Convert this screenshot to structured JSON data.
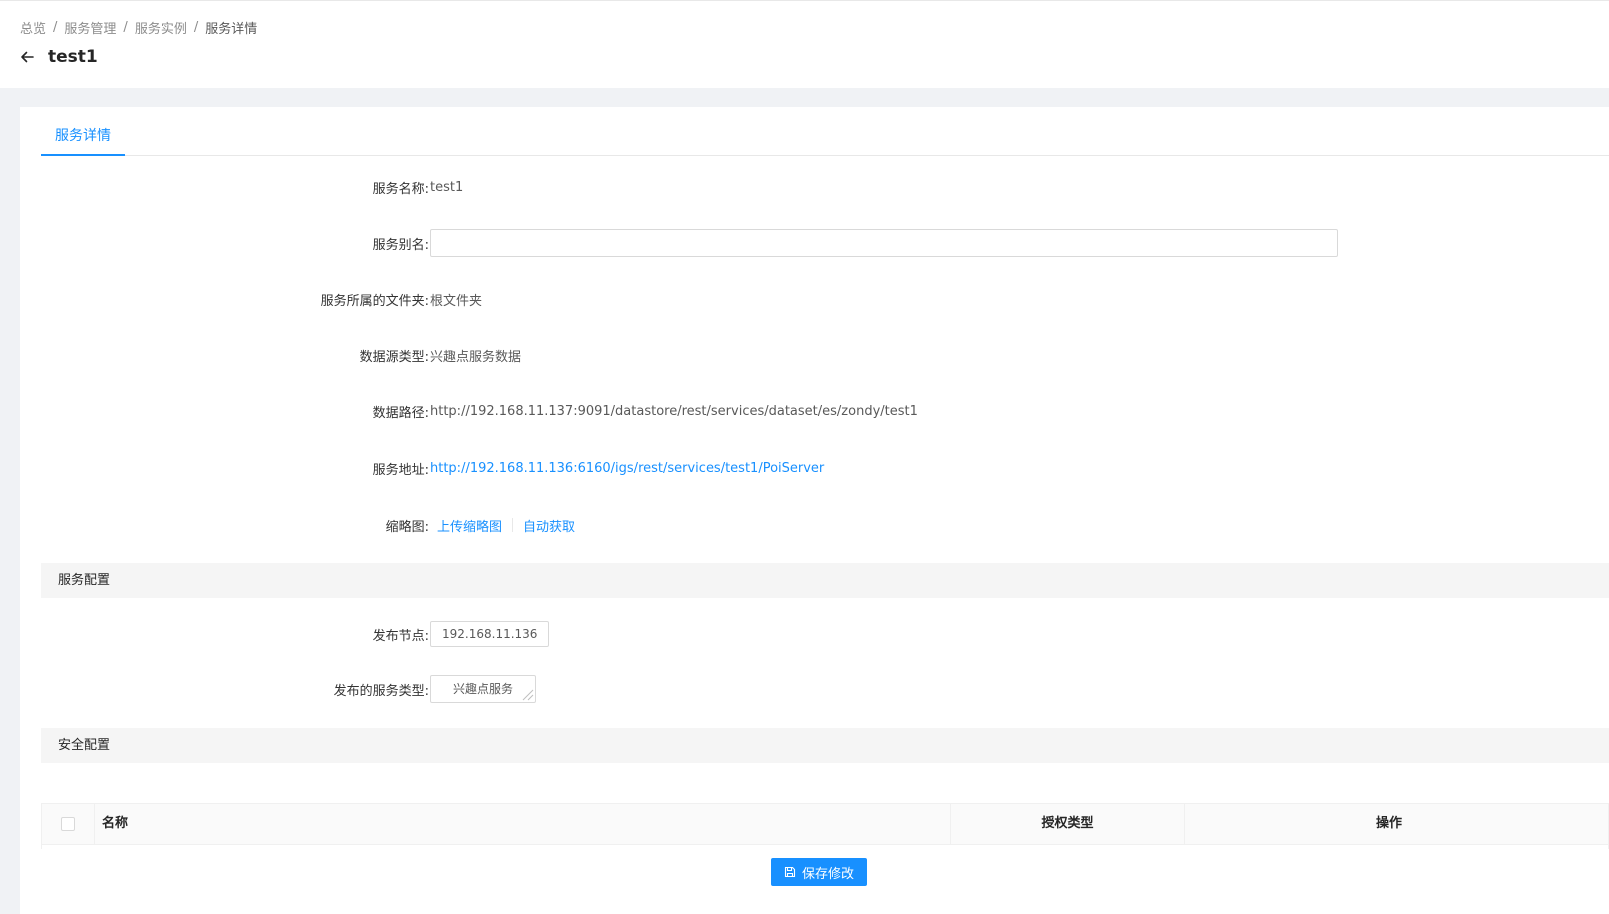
{
  "breadcrumb": {
    "items": [
      "总览",
      "服务管理",
      "服务实例"
    ],
    "current": "服务详情",
    "separator": "/"
  },
  "page": {
    "title": "test1"
  },
  "tabs": [
    {
      "label": "服务详情",
      "active": true
    }
  ],
  "form": {
    "service_name_label": "服务名称:",
    "service_name_value": "test1",
    "alias_label": "服务别名:",
    "alias_value": "",
    "folder_label": "服务所属的文件夹:",
    "folder_value": "根文件夹",
    "datasource_type_label": "数据源类型:",
    "datasource_type_value": "兴趣点服务数据",
    "data_path_label": "数据路径:",
    "data_path_value": "http://192.168.11.137:9091/datastore/rest/services/dataset/es/zondy/test1",
    "service_url_label": "服务地址:",
    "service_url_value": "http://192.168.11.136:6160/igs/rest/services/test1/PoiServer",
    "thumbnail_label": "缩略图:",
    "upload_thumbnail": "上传缩略图",
    "auto_fetch": "自动获取"
  },
  "service_config": {
    "title": "服务配置",
    "node_label": "发布节点:",
    "node_value": "192.168.11.136",
    "service_type_label": "发布的服务类型:",
    "service_type_value": "兴趣点服务"
  },
  "security_config": {
    "title": "安全配置",
    "columns": [
      "名称",
      "授权类型",
      "操作"
    ]
  },
  "actions": {
    "save_label": "保存修改"
  },
  "colors": {
    "primary": "#1890ff",
    "background": "#f0f2f5",
    "section_bg": "#f5f5f5"
  }
}
